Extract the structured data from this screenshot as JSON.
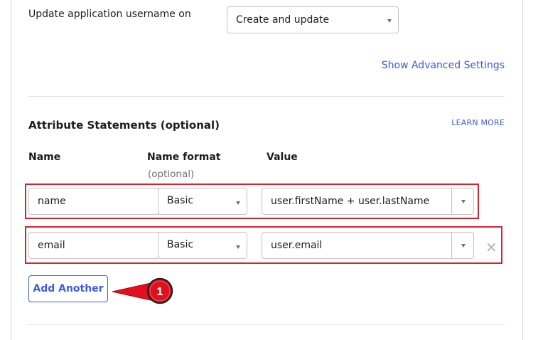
{
  "settings": {
    "update_username_label": "Update application username on",
    "update_username_value": "Create and update",
    "advanced_link": "Show Advanced Settings"
  },
  "attributes": {
    "heading": "Attribute Statements (optional)",
    "learn_more": "LEARN MORE",
    "columns": {
      "name": "Name",
      "name_format": "Name format",
      "name_format_sub": "(optional)",
      "value": "Value"
    },
    "rows": [
      {
        "name": "name",
        "format": "Basic",
        "value": "user.firstName + user.lastName"
      },
      {
        "name": "email",
        "format": "Basic",
        "value": "user.email"
      }
    ],
    "remove_symbol": "×",
    "add_button": "Add Another"
  },
  "annotation": {
    "step": "1"
  },
  "colors": {
    "accent": "#3f59e4",
    "highlight": "#d42430",
    "callout": "#e0101e"
  }
}
